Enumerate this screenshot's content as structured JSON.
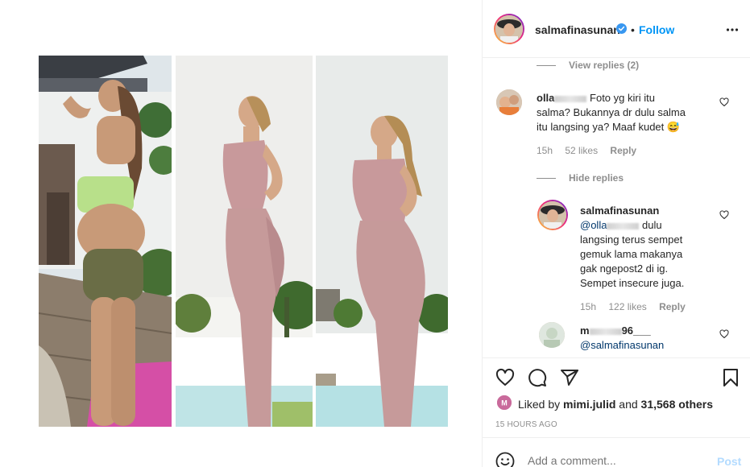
{
  "post": {
    "username": "salmafinasunan",
    "dot": "•",
    "follow_label": "Follow",
    "more_icon": "more-horizontal-icon"
  },
  "comments": {
    "view_replies_1": "View replies (2)",
    "c1": {
      "user_prefix": "olla",
      "text_line1": " Foto yg kiri itu",
      "text_line2": "salma? Bukannya dr dulu salma",
      "text_line3": "itu langsing ya? Maaf kudet 😅",
      "time": "15h",
      "likes": "52 likes",
      "reply": "Reply"
    },
    "hide_replies": "Hide replies",
    "c2": {
      "user": "salmafinasunan",
      "mention_prefix": "@olla",
      "line1_end": " dulu",
      "line2": "langsing terus sempet",
      "line3": "gemuk lama makanya",
      "line4": "gak ngepost2 di ig.",
      "line5": "Sempet insecure juga.",
      "time": "15h",
      "likes": "122 likes",
      "reply": "Reply"
    },
    "c3": {
      "user_prefix": "m",
      "user_suffix": "96___",
      "mention": "@salmafinasunan"
    }
  },
  "actions": {
    "liked_by_prefix": "Liked by ",
    "liked_by_user": "mimi.julid",
    "liked_by_and": " and ",
    "liked_by_others": "31,568 others",
    "timestamp": "15 HOURS AGO"
  },
  "add_comment": {
    "placeholder": "Add a comment...",
    "post_label": "Post"
  },
  "colors": {
    "accent": "#0095f6",
    "text": "#262626",
    "muted": "#8e8e8e",
    "post_disabled": "#b3dbff"
  }
}
